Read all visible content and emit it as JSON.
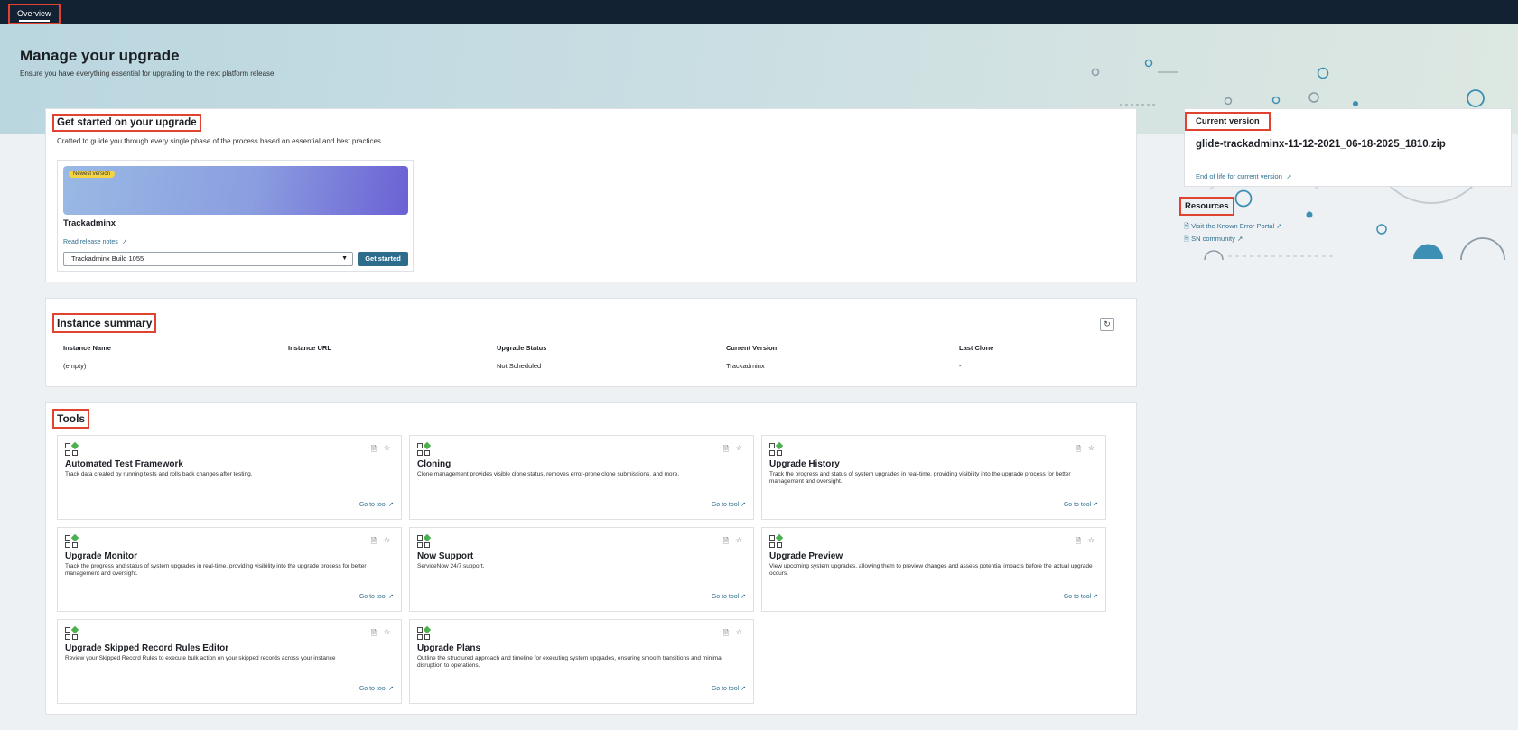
{
  "nav": {
    "tab_overview": "Overview"
  },
  "hero": {
    "title": "Manage your upgrade",
    "subtitle": "Ensure you have everything essential for upgrading to the next platform release."
  },
  "get_started": {
    "title": "Get started on your upgrade",
    "subtitle": "Crafted to guide you through every single phase of the process based on essential and best practices.",
    "card": {
      "badge": "Newest version",
      "name": "Trackadminx",
      "release_notes": "Read release notes",
      "selected_build": "Trackadminx Build 1055",
      "button": "Get started"
    }
  },
  "instance_summary": {
    "title": "Instance summary",
    "columns": [
      "Instance Name",
      "Instance URL",
      "Upgrade Status",
      "Current Version",
      "Last Clone"
    ],
    "row": [
      "(empty)",
      "",
      "Not Scheduled",
      "Trackadminx",
      "-"
    ]
  },
  "tools": {
    "title": "Tools",
    "goto_label": "Go to tool",
    "items": [
      {
        "name": "Automated Test Framework",
        "desc": "Track data created by running tests and rolls back changes after testing."
      },
      {
        "name": "Cloning",
        "desc": "Clone management provides visible clone status, removes error-prone clone submissions, and more."
      },
      {
        "name": "Upgrade History",
        "desc": "Track the progress and status of system upgrades in real-time, providing visibility into the upgrade process for better management and oversight."
      },
      {
        "name": "Upgrade Monitor",
        "desc": "Track the progress and status of system upgrades in real-time, providing visibility into the upgrade process for better management and oversight."
      },
      {
        "name": "Now Support",
        "desc": "ServiceNow 24/7 support."
      },
      {
        "name": "Upgrade Preview",
        "desc": "View upcoming system upgrades, allowing them to preview changes and assess potential impacts before the actual upgrade occurs."
      },
      {
        "name": "Upgrade Skipped Record Rules Editor",
        "desc": "Review your Skipped Record Rules to execute bulk action on your skipped records across your instance"
      },
      {
        "name": "Upgrade Plans",
        "desc": "Outline the structured approach and timeline for executing system upgrades, ensuring smooth transitions and minimal disruption to operations."
      }
    ]
  },
  "current_version": {
    "title": "Current version",
    "value": "glide-trackadminx-11-12-2021_06-18-2025_1810.zip",
    "eol_link": "End of life for current version"
  },
  "resources": {
    "title": "Resources",
    "links": [
      "Visit the Known Error Portal",
      "SN community"
    ]
  },
  "colors": {
    "topbar": "#132232",
    "accent": "#2d6c8c",
    "highlight": "#e0432f",
    "tool_icon_green": "#4caf50"
  }
}
